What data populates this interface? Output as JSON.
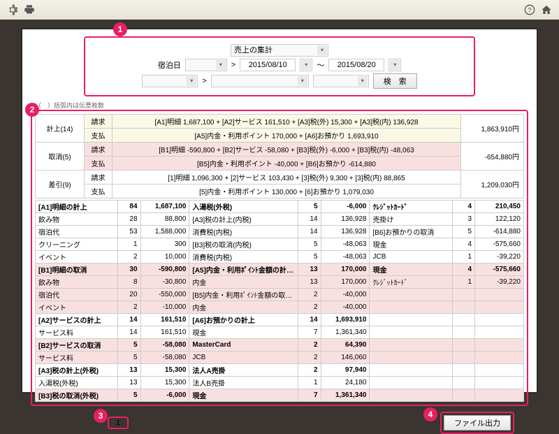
{
  "toolbar": {
    "gear": "⚙",
    "print": "🖨",
    "help": "?",
    "home": "⌂"
  },
  "filters": {
    "report_type": "売上の集計",
    "date_label": "宿泊日",
    "date_from": "2015/08/10",
    "date_to": "2015/08/20",
    "sep_gt": ">",
    "sep_tilde": "～",
    "search_btn": "検　索",
    "note": "（　）括弧内は伝票枚数"
  },
  "summary": {
    "rows": [
      {
        "cls": "row-yel",
        "g": "計上(14)",
        "k": "請求",
        "f": "[A1]明細 1,687,100 + [A2]サービス 161,510 + [A3]税(外) 15,300 + [A3]税(内) 136,928",
        "t": "1,863,910円"
      },
      {
        "cls": "row-yel",
        "g": "",
        "k": "支払",
        "f": "[A5]内金・利用ポイント 170,000 + [A6]お預かり 1,693,910",
        "t": ""
      },
      {
        "cls": "row-pink",
        "g": "取消(5)",
        "k": "請求",
        "f": "[B1]明細 -590,800 + [B2]サービス -58,080 + [B3]税(外) -6,000 + [B3]税(内) -48,063",
        "t": "-654,880円"
      },
      {
        "cls": "row-pink",
        "g": "",
        "k": "支払",
        "f": "[B5]内金・利用ポイント -40,000 + [B6]お預かり -614,880",
        "t": ""
      },
      {
        "cls": "",
        "g": "差引(9)",
        "k": "請求",
        "f": "[1]明細 1,096,300 + [2]サービス 103,430 + [3]税(外) 9,300 + [3]税(内) 88,865",
        "t": "1,209,030円"
      },
      {
        "cls": "",
        "g": "",
        "k": "支払",
        "f": "[5]内金・利用ポイント 130,000 + [6]お預かり 1,079,030",
        "t": ""
      }
    ]
  },
  "detail": {
    "rows": [
      {
        "b": 1,
        "p": 0,
        "c": [
          "[A1]明細の計上",
          "84",
          "1,687,100",
          "入湯税(外税)",
          "5",
          "-6,000",
          "ｸﾚｼﾞｯﾄｶｰﾄﾞ",
          "4",
          "210,450"
        ]
      },
      {
        "b": 0,
        "p": 0,
        "c": [
          "飲み物",
          "28",
          "88,800",
          "[A3]税の計上(内税)",
          "14",
          "136,928",
          "売掛け",
          "3",
          "122,120"
        ]
      },
      {
        "b": 0,
        "p": 0,
        "c": [
          "宿泊代",
          "53",
          "1,588,000",
          "消費税(内税)",
          "14",
          "136,928",
          "[B6]お預かりの取消",
          "5",
          "-614,880"
        ]
      },
      {
        "b": 0,
        "p": 0,
        "c": [
          "クリーニング",
          "1",
          "300",
          "[B3]税の取消(内税)",
          "5",
          "-48,063",
          "現金",
          "4",
          "-575,660"
        ]
      },
      {
        "b": 0,
        "p": 0,
        "c": [
          "イベント",
          "2",
          "10,000",
          "消費税(内税)",
          "5",
          "-48,063",
          "JCB",
          "1",
          "-39,220"
        ]
      },
      {
        "b": 1,
        "p": 1,
        "c": [
          "[B1]明細の取消",
          "30",
          "-590,800",
          "[A5]内金・利用ﾎﾟｲﾝﾄ金額の計…",
          "13",
          "170,000",
          "現金",
          "4",
          "-575,660"
        ]
      },
      {
        "b": 0,
        "p": 1,
        "c": [
          "飲み物",
          "8",
          "-30,800",
          "内金",
          "13",
          "170,000",
          "ｸﾚｼﾞｯﾄｶｰﾄﾞ",
          "1",
          "-39,220"
        ]
      },
      {
        "b": 0,
        "p": 1,
        "c": [
          "宿泊代",
          "20",
          "-550,000",
          "[B5]内金・利用ﾎﾟｲﾝﾄ金額の取…",
          "2",
          "-40,000",
          "",
          "",
          ""
        ]
      },
      {
        "b": 0,
        "p": 1,
        "c": [
          "イベント",
          "2",
          "-10,000",
          "内金",
          "2",
          "-40,000",
          "",
          "",
          ""
        ]
      },
      {
        "b": 1,
        "p": 0,
        "c": [
          "[A2]サービスの計上",
          "14",
          "161,510",
          "[A6]お預かりの計上",
          "14",
          "1,693,910",
          "",
          "",
          ""
        ]
      },
      {
        "b": 0,
        "p": 0,
        "c": [
          "サービス料",
          "14",
          "161,510",
          "現金",
          "7",
          "1,361,340",
          "",
          "",
          ""
        ]
      },
      {
        "b": 1,
        "p": 1,
        "c": [
          "[B2]サービスの取消",
          "5",
          "-58,080",
          "MasterCard",
          "2",
          "64,390",
          "",
          "",
          ""
        ]
      },
      {
        "b": 0,
        "p": 1,
        "c": [
          "サービス料",
          "5",
          "-58,080",
          "JCB",
          "2",
          "146,060",
          "",
          "",
          ""
        ]
      },
      {
        "b": 1,
        "p": 0,
        "c": [
          "[A3]税の計上(外税)",
          "13",
          "15,300",
          "法人A売掛",
          "2",
          "97,940",
          "",
          "",
          ""
        ]
      },
      {
        "b": 0,
        "p": 0,
        "c": [
          "入湯税(外税)",
          "13",
          "15,300",
          "法人B売掛",
          "1",
          "24,180",
          "",
          "",
          ""
        ]
      },
      {
        "b": 1,
        "p": 1,
        "c": [
          "[B3]税の取消(外税)",
          "5",
          "-6,000",
          "現金",
          "7",
          "1,361,340",
          "",
          "",
          ""
        ]
      }
    ]
  },
  "footer": {
    "page": "1",
    "export_btn": "ファイル出力"
  },
  "callouts": {
    "c1": "1",
    "c2": "2",
    "c3": "3",
    "c4": "4"
  }
}
